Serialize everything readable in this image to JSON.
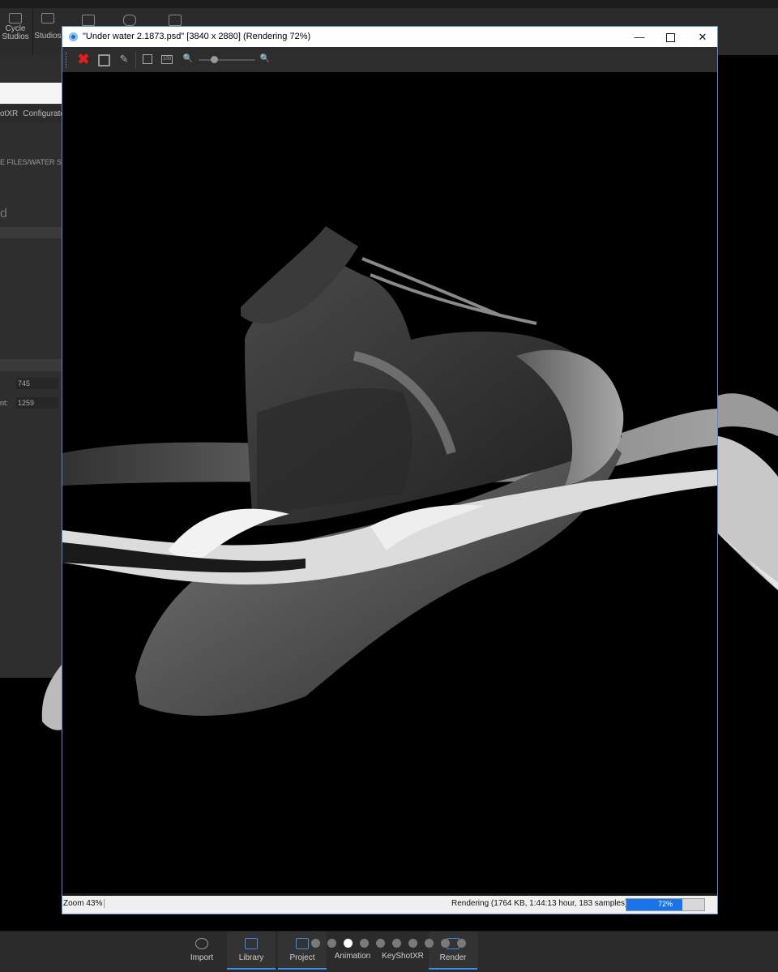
{
  "app_toolbar": {
    "cycle_label_1": "Cycle",
    "cycle_label_2": "Studios",
    "studios_label": "Studios"
  },
  "left_panel": {
    "tabs": [
      "otXR",
      "Configurato"
    ],
    "path_text": "E FILES/WATER SC",
    "dim_text": "d",
    "fields": [
      {
        "key": "",
        "value": "745"
      },
      {
        "key": "nt:",
        "value": "1259"
      }
    ]
  },
  "render_window": {
    "title": "\"Under water 2.1873.psd\" [3840 x 2880] (Rendering 72%)",
    "controls": {
      "minimize": "—",
      "maximize": "",
      "close": "✕"
    },
    "toolbar": {
      "cancel_icon": "✖",
      "edit_icon": "✎",
      "zoom_100_icon": "100",
      "zoom_out_icon": "🔍",
      "zoom_in_icon": "🔍"
    },
    "status": {
      "zoom": "Zoom 43%",
      "rendering": "Rendering (1764 KB, 1:44:13 hour, 183 samples)",
      "progress_label": "72%",
      "progress_value": 0.72
    }
  },
  "dock": {
    "items": [
      {
        "label": "Import"
      },
      {
        "label": "Library"
      },
      {
        "label": "Project"
      },
      {
        "label": "Animation"
      },
      {
        "label": "KeyShotXR"
      },
      {
        "label": "Render"
      }
    ]
  },
  "colors": {
    "accent": "#1a73e8",
    "cancel_red": "#e0201c",
    "window_border": "#5a8fc8"
  }
}
